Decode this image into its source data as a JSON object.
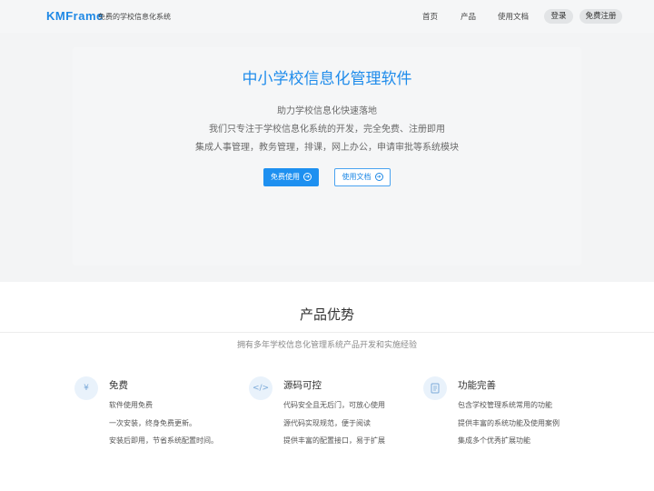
{
  "header": {
    "logo": "KMFrame",
    "tagline": "免费的学校信息化系统",
    "nav": [
      "首页",
      "产品",
      "使用文档"
    ],
    "login": "登录",
    "register": "免费注册"
  },
  "hero": {
    "title": "中小学校信息化管理软件",
    "lines": [
      "助力学校信息化快速落地",
      "我们只专注于学校信息化系统的开发，完全免费、注册即用",
      "集成人事管理，教务管理，排课，网上办公，申请审批等系统模块"
    ],
    "primary_button": "免费使用",
    "secondary_button": "使用文档"
  },
  "features": {
    "title": "产品优势",
    "subtitle": "拥有多年学校信息化管理系统产品开发和实施经验",
    "items": [
      {
        "icon": "yen-icon",
        "title": "免费",
        "points": [
          "软件使用免费",
          "一次安装，终身免费更新。",
          "安装后即用，节省系统配置时间。"
        ]
      },
      {
        "icon": "code-icon",
        "title": "源码可控",
        "points": [
          "代码安全且无后门，可放心使用",
          "源代码实现规范，便于阅读",
          "提供丰富的配置接口，易于扩展"
        ]
      },
      {
        "icon": "document-icon",
        "title": "功能完善",
        "points": [
          "包含学校管理系统常用的功能",
          "提供丰富的系统功能及使用案例",
          "集成多个优秀扩展功能"
        ]
      }
    ]
  },
  "colors": {
    "accent": "#1e88e5",
    "hero_bg": "#f3f4f5",
    "icon_bg": "#e9f2fb"
  }
}
